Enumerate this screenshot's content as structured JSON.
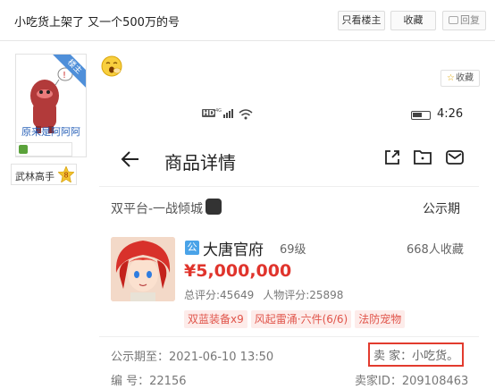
{
  "thread": {
    "title": "小吃货上架了 又一个500万的号",
    "only_op_label": "只看楼主",
    "favorite_label": "收藏",
    "reply_label": "回复"
  },
  "user": {
    "op_ribbon": "楼主",
    "name": "原来是阿阿阿",
    "level_label": "武林高手",
    "level_num": "8"
  },
  "post": {
    "favorite_label": "收藏",
    "favorite_icon": "star-icon",
    "emoji_icon": "yawn-emoji-icon"
  },
  "phone": {
    "status": {
      "hd": "HD",
      "time": "4:26"
    },
    "nav": {
      "title": "商品详情"
    },
    "platform": "双平台-一战倾城",
    "publicity_label": "公示期",
    "product": {
      "server_badge": "公",
      "server_name": "大唐官府",
      "level": "69级",
      "fav_count": "668人收藏",
      "price": "¥5,000,000",
      "total_score": "总评分:45649",
      "char_score": "人物评分:25898",
      "tags": [
        "双蓝装备x9",
        "风起雷涌·六件(6/6)",
        "法防宠物"
      ]
    },
    "info": {
      "pub_date": "公示期至：2021-06-10 13:50",
      "seller": "卖 家：小吃货。",
      "item_no": "编 号：22156",
      "seller_id": "卖家ID：209108463"
    }
  },
  "colors": {
    "price_red": "#e0342c",
    "tag_bg": "#fdecea",
    "highlight_border": "#e23b2e",
    "ribbon_blue": "#4f8fd9",
    "link_blue": "#2a62b8"
  }
}
